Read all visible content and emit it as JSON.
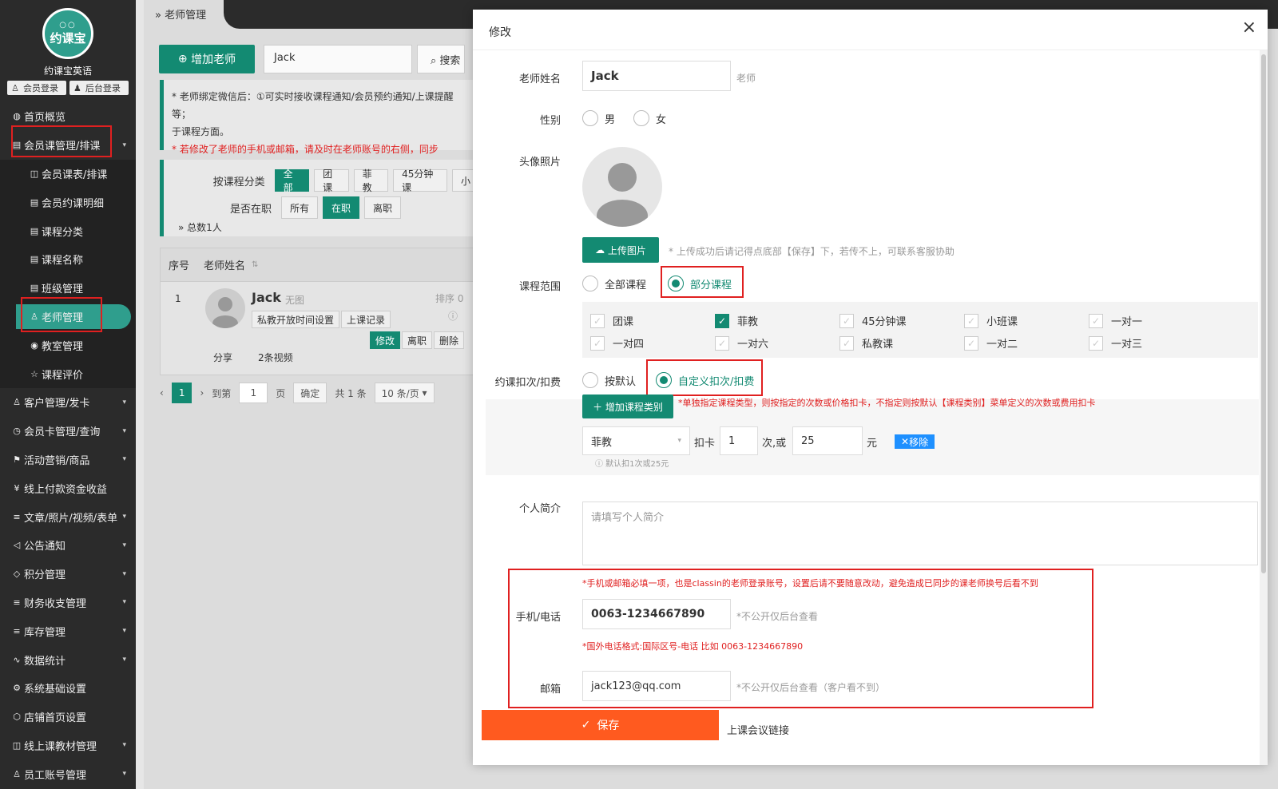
{
  "sidebar": {
    "logo_text": "约课宝",
    "brand_name": "约课宝英语",
    "member_login": "会员登录",
    "admin_login": "后台登录",
    "items": [
      {
        "label": "首页概览",
        "icon": "globe-icon"
      },
      {
        "label": "会员课管理/排课",
        "icon": "doc-icon",
        "arrow": true
      },
      {
        "label": "会员课表/排课",
        "icon": "book-icon",
        "sub": true
      },
      {
        "label": "会员约课明细",
        "icon": "doc-icon",
        "sub": true
      },
      {
        "label": "课程分类",
        "icon": "doc-icon",
        "sub": true
      },
      {
        "label": "课程名称",
        "icon": "doc-icon",
        "sub": true
      },
      {
        "label": "班级管理",
        "icon": "doc-icon",
        "sub": true
      },
      {
        "label": "老师管理",
        "icon": "user-icon",
        "sub": true,
        "active": true
      },
      {
        "label": "教室管理",
        "icon": "pin-icon",
        "sub": true
      },
      {
        "label": "课程评价",
        "icon": "star-icon",
        "sub": true
      },
      {
        "label": "客户管理/发卡",
        "icon": "user-icon",
        "arrow": true
      },
      {
        "label": "会员卡管理/查询",
        "icon": "clock-icon",
        "arrow": true
      },
      {
        "label": "活动营销/商品",
        "icon": "flag-icon",
        "arrow": true
      },
      {
        "label": "线上付款资金收益",
        "icon": "money-icon"
      },
      {
        "label": "文章/照片/视频/表单",
        "icon": "sliders-icon",
        "arrow": true
      },
      {
        "label": "公告通知",
        "icon": "speaker-icon",
        "arrow": true
      },
      {
        "label": "积分管理",
        "icon": "diamond-icon",
        "arrow": true
      },
      {
        "label": "财务收支管理",
        "icon": "sliders-icon",
        "arrow": true
      },
      {
        "label": "库存管理",
        "icon": "sliders-icon",
        "arrow": true
      },
      {
        "label": "数据统计",
        "icon": "chart-icon",
        "arrow": true
      },
      {
        "label": "系统基础设置",
        "icon": "gear-icon"
      },
      {
        "label": "店铺首页设置",
        "icon": "box-icon"
      },
      {
        "label": "线上课教材管理",
        "icon": "book-icon",
        "arrow": true
      },
      {
        "label": "员工账号管理",
        "icon": "user-icon",
        "arrow": true
      }
    ]
  },
  "main": {
    "breadcrumb": "老师管理",
    "add_teacher": "增加老师",
    "search_value": "Jack",
    "search_button": "搜索",
    "notice_line1": "* 老师绑定微信后：①可实时接收课程通知/会员预约通知/上课提醒等；",
    "notice_line2": "于课程方面。",
    "notice_line3": "* 若修改了老师的手机或邮箱，请及时在老师账号的右侧，同步",
    "filter_course_label": "按课程分类",
    "filter_course_tags": [
      "全部",
      "团课",
      "菲教",
      "45分钟课",
      "小"
    ],
    "filter_status_label": "是否在职",
    "filter_status_tags": [
      "所有",
      "在职",
      "离职"
    ],
    "total": "总数1人",
    "table_headers": [
      "序号",
      "老师姓名"
    ],
    "row": {
      "index": "1",
      "name": "Jack",
      "sub": "无图",
      "sort": "排序 0",
      "btn_private_time": "私教开放时间设置",
      "btn_records": "上课记录",
      "btn_edit": "修改",
      "btn_leave": "离职",
      "btn_delete": "删除",
      "share": "分享",
      "videos": "2条视频"
    },
    "pager": {
      "current": "1",
      "goto": "到第",
      "goto_value": "1",
      "page_unit": "页",
      "confirm": "确定",
      "total": "共 1 条",
      "per_page": "10 条/页"
    }
  },
  "modal": {
    "title": "修改",
    "close": "×",
    "name_label": "老师姓名",
    "name_value": "Jack",
    "name_suffix": "老师",
    "gender_label": "性别",
    "gender_male": "男",
    "gender_female": "女",
    "avatar_label": "头像照片",
    "upload_button": "上传图片",
    "upload_hint": "* 上传成功后请记得点底部【保存】下，若传不上，可联系客服协助",
    "scope_label": "课程范围",
    "scope_all": "全部课程",
    "scope_partial": "部分课程",
    "courses": [
      {
        "label": "团课",
        "checked": false
      },
      {
        "label": "菲教",
        "checked": true
      },
      {
        "label": "45分钟课",
        "checked": false
      },
      {
        "label": "小班课",
        "checked": false
      },
      {
        "label": "一对一",
        "checked": false
      },
      {
        "label": "一对四",
        "checked": false
      },
      {
        "label": "一对六",
        "checked": false
      },
      {
        "label": "私教课",
        "checked": false
      },
      {
        "label": "一对二",
        "checked": false
      },
      {
        "label": "一对三",
        "checked": false
      }
    ],
    "deduct_label": "约课扣次/扣费",
    "deduct_default": "按默认",
    "deduct_custom": "自定义扣次/扣费",
    "add_category": "增加课程类别",
    "deduct_note": "*单独指定课程类型，则按指定的次数或价格扣卡，不指定则按默认【课程类别】菜单定义的次数或费用扣卡",
    "course_select": "菲教",
    "deduct_card": "扣卡",
    "times_value": "1",
    "times_unit": "次,或",
    "amount_value": "25",
    "amount_unit": "元",
    "remove": "移除",
    "deduct_default_note": "ⓘ 默认扣1次或25元",
    "bio_label": "个人简介",
    "bio_placeholder": "请填写个人简介",
    "contact_note": "*手机或邮箱必填一项，也是classin的老师登录账号，设置后请不要随意改动，避免造成已同步的课老师换号后看不到",
    "phone_label": "手机/电话",
    "phone_value": "0063-1234667890",
    "phone_hint": "*不公开仅后台查看",
    "phone_format": "*国外电话格式:国际区号-电话 比如 0063-1234667890",
    "email_label": "邮箱",
    "email_value": "jack123@qq.com",
    "email_hint": "*不公开仅后台查看（客户看不到）",
    "save": "保存",
    "meeting_link": "上课会议链接"
  },
  "colors": {
    "primary": "#138a72",
    "danger": "#e02020",
    "save": "#ff5a1f",
    "remove": "#1e90ff"
  }
}
